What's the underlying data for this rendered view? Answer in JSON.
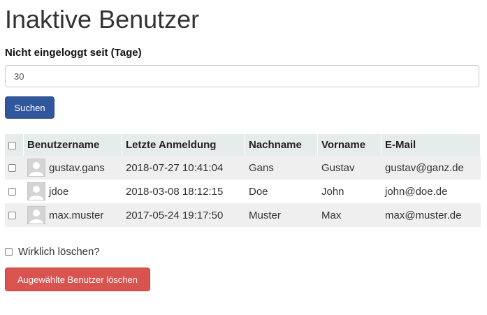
{
  "page": {
    "title": "Inaktive Benutzer"
  },
  "filter": {
    "label": "Nicht eingeloggt seit (Tage)",
    "value": "30",
    "search_button": "Suchen"
  },
  "table": {
    "columns": [
      "Benutzername",
      "Letzte Anmeldung",
      "Nachname",
      "Vorname",
      "E-Mail"
    ],
    "rows": [
      {
        "username": "gustav.gans",
        "last_login": "2018-07-27 10:41:04",
        "lastname": "Gans",
        "firstname": "Gustav",
        "email": "gustav@ganz.de"
      },
      {
        "username": "jdoe",
        "last_login": "2018-03-08 18:12:15",
        "lastname": "Doe",
        "firstname": "John",
        "email": "john@doe.de"
      },
      {
        "username": "max.muster",
        "last_login": "2017-05-24 19:17:50",
        "lastname": "Muster",
        "firstname": "Max",
        "email": "max@muster.de"
      }
    ]
  },
  "confirm": {
    "label": "Wirklich löschen?"
  },
  "delete_button": "Augewählte Benutzer löschen",
  "colors": {
    "primary": "#30579b",
    "danger": "#d9534f",
    "header_bg": "#e6ebeb",
    "row_alt": "#efefef"
  }
}
